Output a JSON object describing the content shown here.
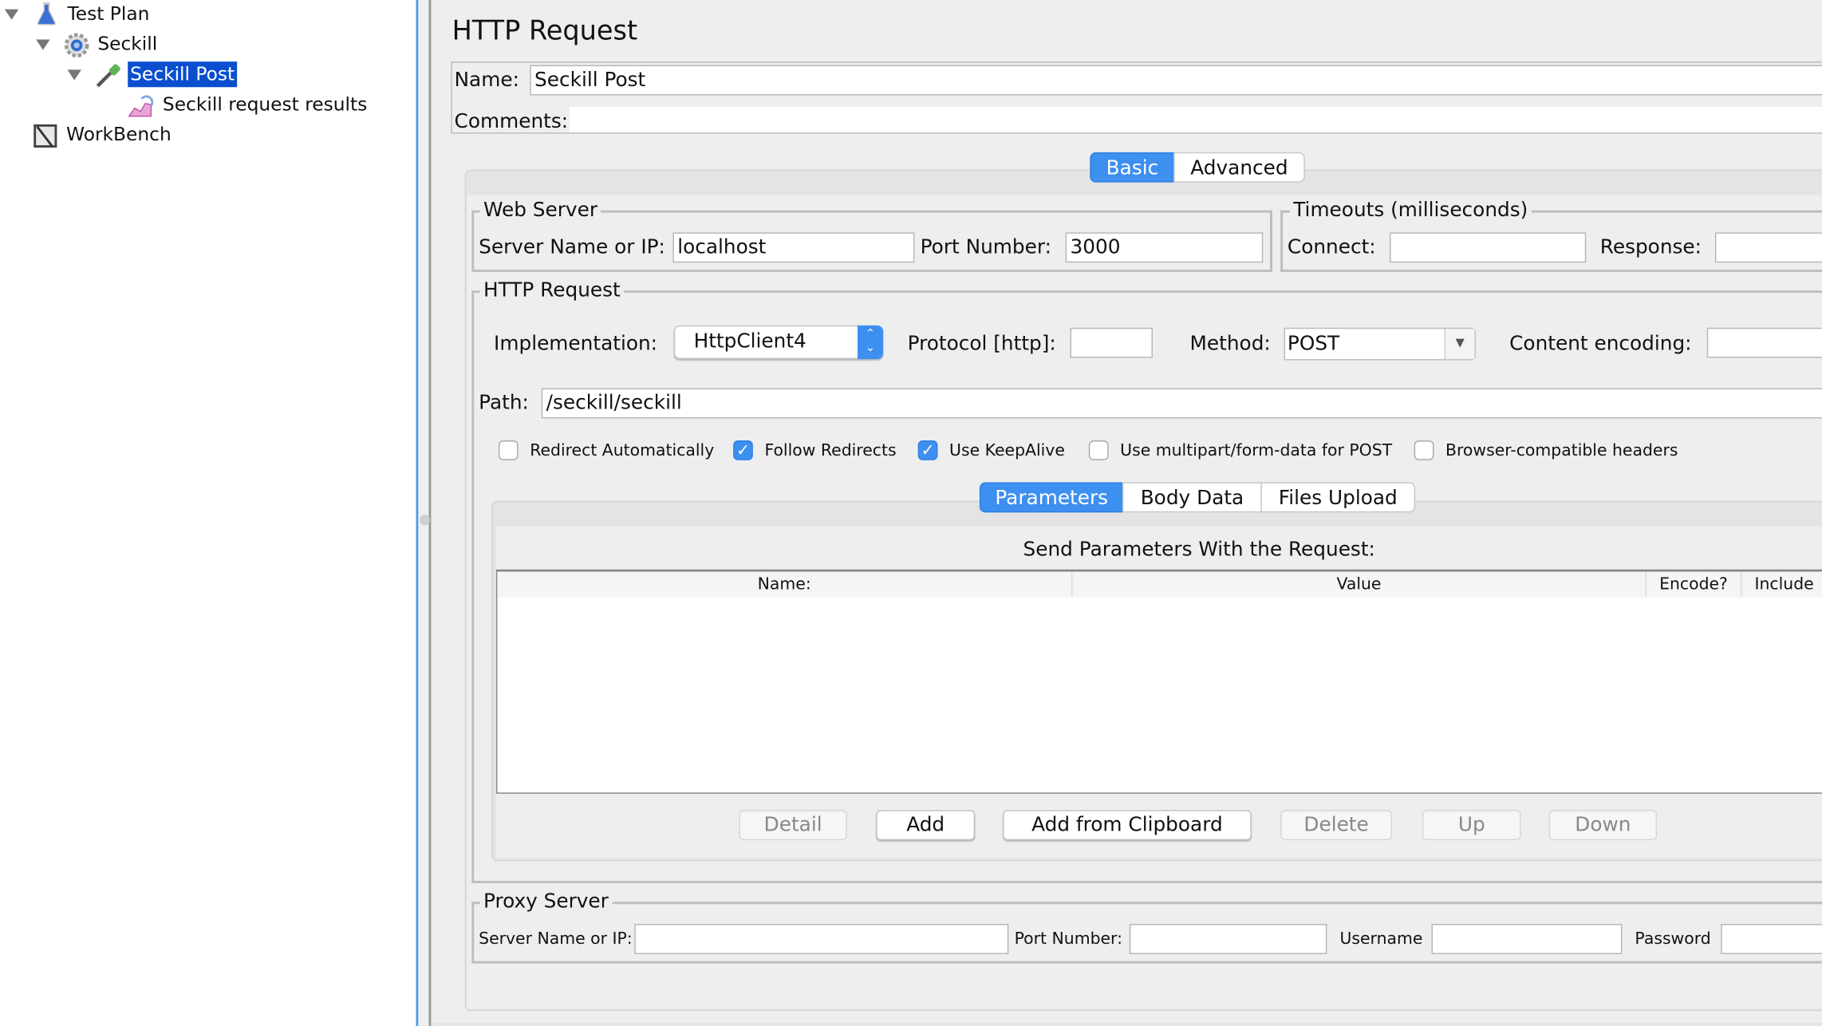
{
  "tree": {
    "items": [
      {
        "label": "Test Plan",
        "icon": "flask-icon",
        "expanded": true
      },
      {
        "label": "Seckill",
        "icon": "gear-icon",
        "expanded": true
      },
      {
        "label": "Seckill Post",
        "icon": "pipette-icon",
        "expanded": true,
        "selected": true
      },
      {
        "label": "Seckill request results",
        "icon": "graph-icon"
      },
      {
        "label": "WorkBench",
        "icon": "workbench-icon"
      }
    ]
  },
  "panel": {
    "title": "HTTP Request",
    "name_label": "Name:",
    "name_value": "Seckill Post",
    "comments_label": "Comments:",
    "comments_value": "",
    "tabs": [
      {
        "label": "Basic",
        "active": true
      },
      {
        "label": "Advanced",
        "active": false
      }
    ]
  },
  "web_server": {
    "legend": "Web Server",
    "server_label": "Server Name or IP:",
    "server_value": "localhost",
    "port_label": "Port Number:",
    "port_value": "3000"
  },
  "timeouts": {
    "legend": "Timeouts (milliseconds)",
    "connect_label": "Connect:",
    "connect_value": "",
    "response_label": "Response:",
    "response_value": ""
  },
  "http_request": {
    "legend": "HTTP Request",
    "implementation_label": "Implementation:",
    "implementation_value": "HttpClient4",
    "protocol_label": "Protocol [http]:",
    "protocol_value": "",
    "method_label": "Method:",
    "method_value": "POST",
    "encoding_label": "Content encoding:",
    "encoding_value": "",
    "path_label": "Path:",
    "path_value": "/seckill/seckill",
    "checkboxes": [
      {
        "label": "Redirect Automatically",
        "checked": false
      },
      {
        "label": "Follow Redirects",
        "checked": true
      },
      {
        "label": "Use KeepAlive",
        "checked": true
      },
      {
        "label": "Use multipart/form-data for POST",
        "checked": false
      },
      {
        "label": "Browser-compatible headers",
        "checked": false
      }
    ],
    "subtabs": [
      {
        "label": "Parameters",
        "active": true
      },
      {
        "label": "Body Data",
        "active": false
      },
      {
        "label": "Files Upload",
        "active": false
      }
    ],
    "params_title": "Send Parameters With the Request:",
    "columns": [
      "Name:",
      "Value",
      "Encode?",
      "Include"
    ],
    "rows": [],
    "buttons": [
      {
        "label": "Detail",
        "enabled": false
      },
      {
        "label": "Add",
        "enabled": true
      },
      {
        "label": "Add from Clipboard",
        "enabled": true
      },
      {
        "label": "Delete",
        "enabled": false
      },
      {
        "label": "Up",
        "enabled": false
      },
      {
        "label": "Down",
        "enabled": false
      }
    ]
  },
  "proxy": {
    "legend": "Proxy Server",
    "server_label": "Server Name or IP:",
    "server_value": "",
    "port_label": "Port Number:",
    "port_value": "",
    "username_label": "Username",
    "username_value": "",
    "password_label": "Password",
    "password_value": ""
  },
  "colors": {
    "selection": "#0b4fcf",
    "accent": "#3d8ff0"
  }
}
